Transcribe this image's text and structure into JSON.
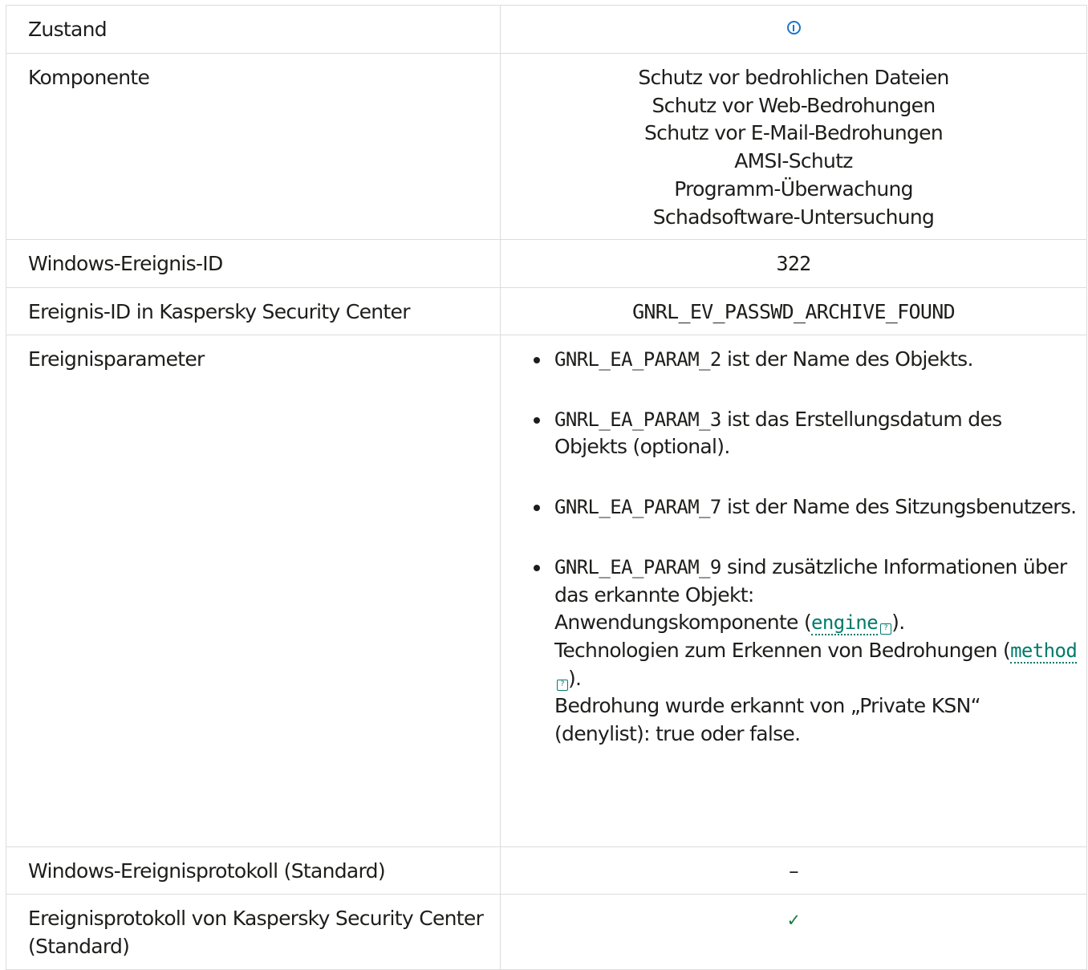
{
  "rows": [
    {
      "label": "Zustand",
      "icon": "info-icon"
    },
    {
      "label": "Komponente",
      "values": [
        "Schutz vor bedrohlichen Dateien",
        "Schutz vor Web-Bedrohungen",
        "Schutz vor E-Mail-Bedrohungen",
        "AMSI-Schutz",
        "Programm-Überwachung",
        "Schadsoftware-Untersuchung"
      ]
    },
    {
      "label": "Windows-Ereignis-ID",
      "value": "322"
    },
    {
      "label": "Ereignis-ID in Kaspersky Security Center",
      "value": "GNRL_EV_PASSWD_ARCHIVE_FOUND"
    },
    {
      "label": "Ereignisparameter"
    },
    {
      "label": "Windows-Ereignisprotokoll (Standard)",
      "value": "–"
    },
    {
      "label": "Ereignisprotokoll von Kaspersky Security Center (Standard)",
      "icon": "check-icon",
      "icon_glyph": "✓"
    }
  ],
  "params": [
    {
      "code": "GNRL_EA_PARAM_2",
      "text": " ist der Name des Objekts."
    },
    {
      "code": "GNRL_EA_PARAM_3",
      "text": " ist das Erstellungsdatum des Objekts (optional)."
    },
    {
      "code": "GNRL_EA_PARAM_7",
      "text": " ist der Name des Sitzungsbenutzers."
    },
    {
      "code": "GNRL_EA_PARAM_9",
      "text": " sind zusätzliche Informationen über das erkannte Objekt:",
      "line1_pre": "Anwendungskomponente (",
      "line1_link": "engine",
      "line1_post": ").",
      "line2_pre": "Technologien zum Erkennen von Bedrohungen (",
      "line2_link": "method",
      "line2_post": ").",
      "line3": "Bedrohung wurde erkannt von „Private KSN“ (denylist): true oder false."
    }
  ],
  "help_icon_glyph": "?",
  "colors": {
    "info": "#1a76c8",
    "check": "#177c3e",
    "link": "#007b6c",
    "border": "#dcdcdc"
  }
}
